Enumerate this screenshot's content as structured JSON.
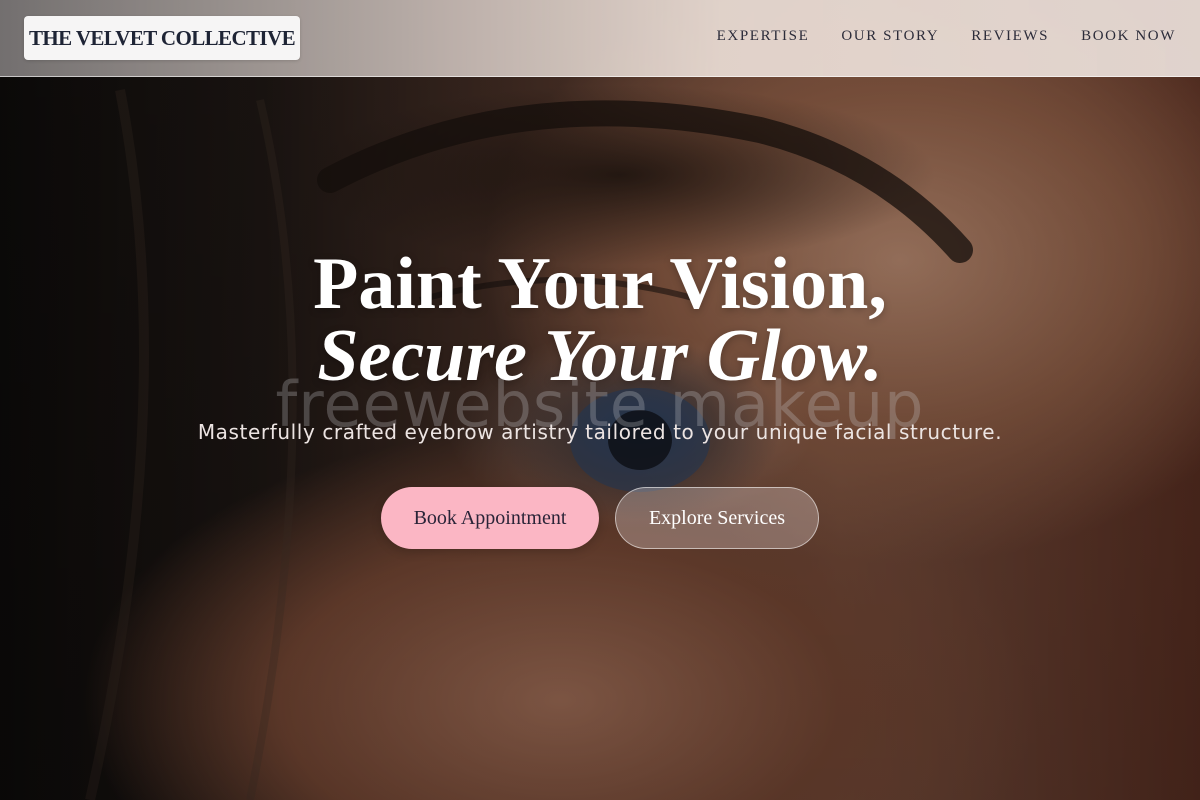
{
  "header": {
    "brand": "THE VELVET COLLECTIVE",
    "nav": [
      {
        "label": "EXPERTISE"
      },
      {
        "label": "OUR STORY"
      },
      {
        "label": "REVIEWS"
      },
      {
        "label": "BOOK NOW"
      }
    ]
  },
  "hero": {
    "title_line1": "Paint Your Vision,",
    "title_line2": "Secure Your Glow.",
    "watermark": "freewebsite makeup",
    "subtitle": "Masterfully crafted eyebrow artistry tailored to your unique facial structure.",
    "primary_button": "Book Appointment",
    "secondary_button": "Explore Services"
  },
  "colors": {
    "accent_pink": "#fbb6c4",
    "brand_text": "#1e2435",
    "nav_text": "#2c2c3a"
  }
}
